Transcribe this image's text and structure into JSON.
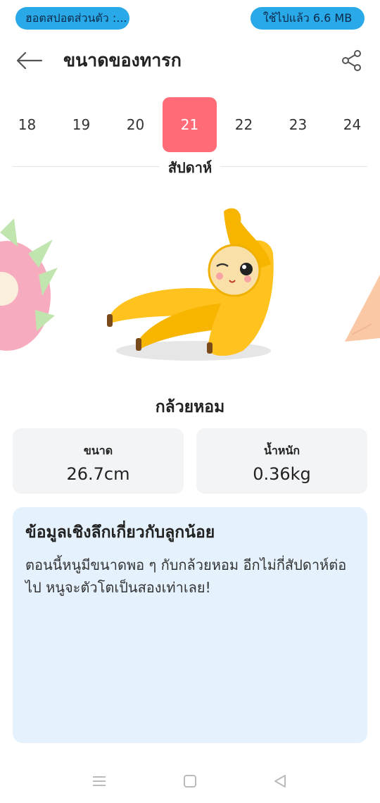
{
  "status_bar": {
    "hotspot_label": "ฮอตสปอตส่วนตัว :...",
    "data_usage": "ใช้ไปแล้ว 6.6 MB"
  },
  "header": {
    "title": "ขนาดของทารก",
    "back_icon": "arrow-left-icon",
    "share_icon": "share-icon"
  },
  "weeks": {
    "items": [
      "18",
      "19",
      "20",
      "21",
      "22",
      "23",
      "24"
    ],
    "selected": "21",
    "label": "สัปดาห์"
  },
  "fruit": {
    "name": "กล้วยหอม"
  },
  "stats": {
    "size_label": "ขนาด",
    "size_value": "26.7cm",
    "weight_label": "น้ำหนัก",
    "weight_value": "0.36kg"
  },
  "insight": {
    "title": "ข้อมูลเชิงลึกเกี่ยวกับลูกน้อย",
    "text": "ตอนนี้หนูมีขนาดพอ ๆ กับกล้วยหอม อีกไม่กี่สัปดาห์ต่อไป หนูจะตัวโตเป็นสองเท่าเลย!"
  },
  "colors": {
    "accent": "#ff6b77",
    "status_pill": "#29a9e8",
    "insight_bg": "#e5f2fd",
    "card_bg": "#f3f4f6"
  },
  "nav": {
    "icons": [
      "menu-icon",
      "home-square-icon",
      "back-triangle-icon"
    ]
  }
}
